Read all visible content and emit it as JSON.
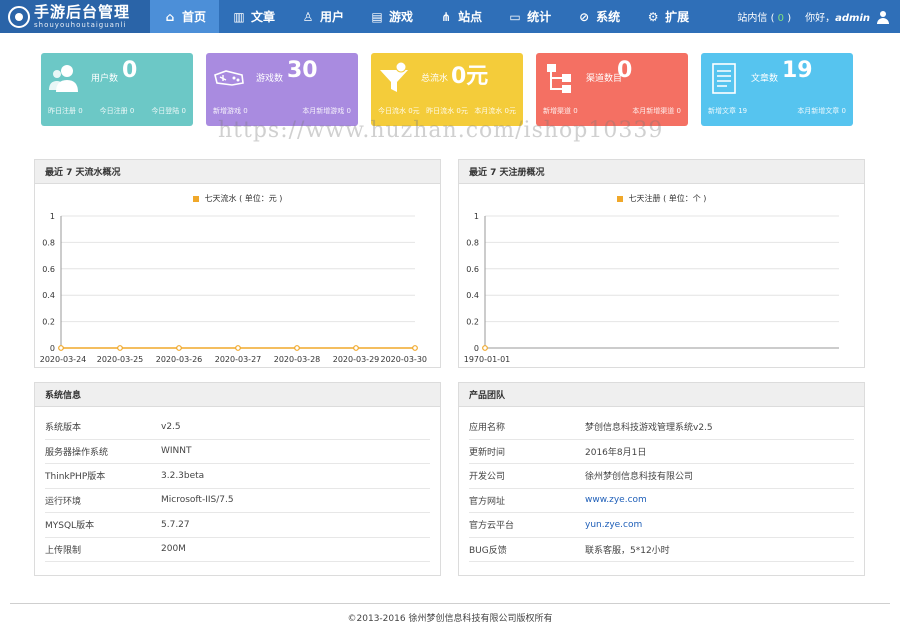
{
  "brand": {
    "title": "手游后台管理",
    "subtitle": "shouyouhoutaiguanli"
  },
  "nav": [
    {
      "label": "首页",
      "icon": "home-icon",
      "glyph": "⌂",
      "active": true
    },
    {
      "label": "文章",
      "icon": "bar-chart-icon",
      "glyph": "▥"
    },
    {
      "label": "用户",
      "icon": "users-icon",
      "glyph": "♙"
    },
    {
      "label": "游戏",
      "icon": "document-icon",
      "glyph": "▤"
    },
    {
      "label": "站点",
      "icon": "sitemap-icon",
      "glyph": "⋔"
    },
    {
      "label": "统计",
      "icon": "monitor-icon",
      "glyph": "▭"
    },
    {
      "label": "系统",
      "icon": "link-icon",
      "glyph": "⊘"
    },
    {
      "label": "扩展",
      "icon": "gear-icon",
      "glyph": "⚙"
    }
  ],
  "user_area": {
    "messages_label": "站内信",
    "messages_count": "0",
    "greeting": "你好，",
    "username": "admin"
  },
  "cards": [
    {
      "label": "用户数",
      "value": "0",
      "color": "#6cc8c6",
      "icon": "user-group-icon",
      "foot": [
        "昨日注册 0",
        "今日注册 0",
        "今日登陆 0"
      ]
    },
    {
      "label": "游戏数",
      "value": "30",
      "color": "#a98be0",
      "icon": "gamepad-icon",
      "foot": [
        "新增游戏 0",
        "本月新增游戏 0"
      ]
    },
    {
      "label": "总流水",
      "value": "0元",
      "color": "#f4cc3a",
      "icon": "funnel-icon",
      "foot": [
        "今日流水 0元",
        "昨日流水 0元",
        "本月流水 0元"
      ]
    },
    {
      "label": "渠道数目",
      "value": "0",
      "color": "#f47063",
      "icon": "tree-icon",
      "foot": [
        "新增渠道 0",
        "本月新增渠道 0"
      ]
    },
    {
      "label": "文章数",
      "value": "19",
      "color": "#56c4ef",
      "icon": "article-icon",
      "foot": [
        "新增文章 19",
        "本月新增文章 0"
      ]
    }
  ],
  "watermark": "https://www.huzhan.com/ishop10339",
  "flow_panel": {
    "title": "最近 7 天流水概况",
    "legend": "七天流水 ( 单位：元 )"
  },
  "reg_panel": {
    "title": "最近 7 天注册概况",
    "legend": "七天注册 ( 单位：个 )"
  },
  "chart_data": [
    {
      "type": "line",
      "title": "最近 7 天流水概况",
      "x": [
        "2020-03-24",
        "2020-03-25",
        "2020-03-26",
        "2020-03-27",
        "2020-03-28",
        "2020-03-29",
        "2020-03-30"
      ],
      "series": [
        {
          "name": "七天流水 ( 单位：元 )",
          "values": [
            0,
            0,
            0,
            0,
            0,
            0,
            0
          ],
          "color": "#f0a82a"
        }
      ],
      "ylim": [
        0,
        1
      ],
      "yticks": [
        "0",
        "0.2",
        "0.4",
        "0.6",
        "0.8",
        "1"
      ],
      "grid": true,
      "legend": "top-center"
    },
    {
      "type": "line",
      "title": "最近 7 天注册概况",
      "x": [
        "1970-01-01"
      ],
      "series": [
        {
          "name": "七天注册 ( 单位：个 )",
          "values": [
            0
          ],
          "color": "#f0a82a"
        }
      ],
      "ylim": [
        0,
        1
      ],
      "yticks": [
        "0",
        "0.2",
        "0.4",
        "0.6",
        "0.8",
        "1"
      ],
      "grid": true,
      "legend": "top-center"
    }
  ],
  "system_info": {
    "title": "系统信息",
    "rows": [
      {
        "key": "系统版本",
        "value": "v2.5"
      },
      {
        "key": "服务器操作系统",
        "value": "WINNT"
      },
      {
        "key": "ThinkPHP版本",
        "value": "3.2.3beta"
      },
      {
        "key": "运行环境",
        "value": "Microsoft-IIS/7.5"
      },
      {
        "key": "MYSQL版本",
        "value": "5.7.27"
      },
      {
        "key": "上传限制",
        "value": "200M"
      }
    ]
  },
  "product_team": {
    "title": "产品团队",
    "rows": [
      {
        "key": "应用名称",
        "value": "梦创信息科技游戏管理系统v2.5"
      },
      {
        "key": "更新时间",
        "value": "2016年8月1日"
      },
      {
        "key": "开发公司",
        "value": "徐州梦创信息科技有限公司"
      },
      {
        "key": "官方网址",
        "value": "www.zye.com",
        "link": true
      },
      {
        "key": "官方云平台",
        "value": "yun.zye.com",
        "link": true
      },
      {
        "key": "BUG反馈",
        "value": "联系客服，5*12小时"
      }
    ]
  },
  "footer": "©2013-2016 徐州梦创信息科技有限公司版权所有"
}
